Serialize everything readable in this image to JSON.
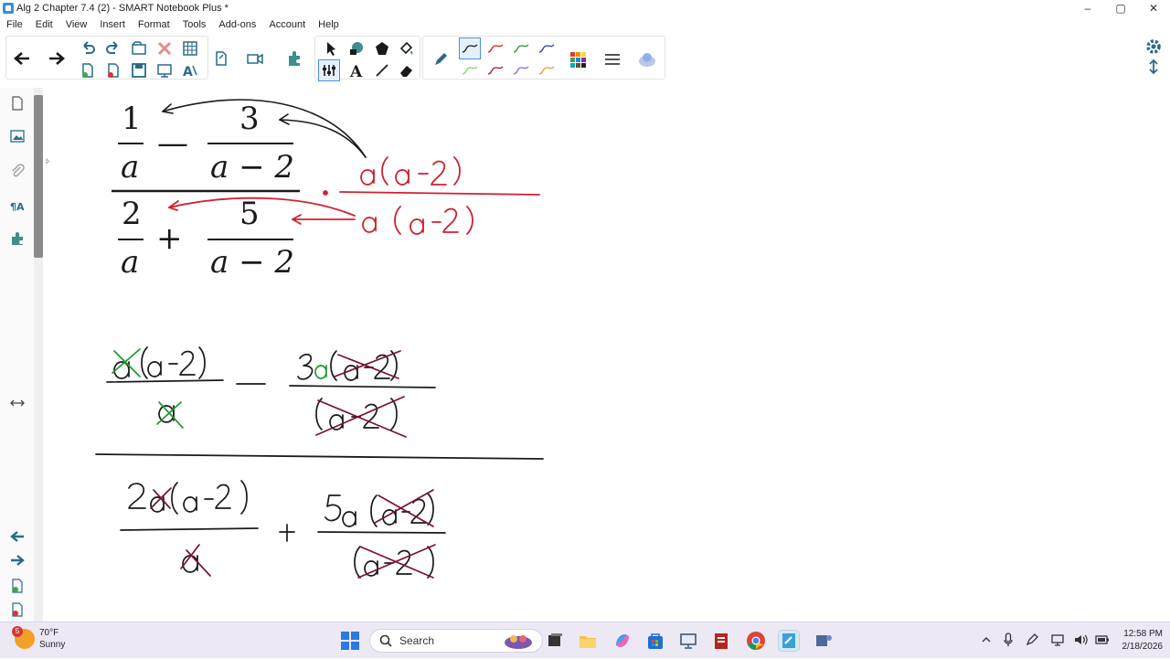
{
  "window": {
    "title": "Alg 2 Chapter 7.4 (2) - SMART Notebook Plus *",
    "controls": [
      "–",
      "▢",
      "✕"
    ]
  },
  "menu": [
    "File",
    "Edit",
    "View",
    "Insert",
    "Format",
    "Tools",
    "Add-ons",
    "Account",
    "Help"
  ],
  "toolbar": {
    "icons": [
      "back-arrow-icon",
      "forward-arrow-icon",
      "undo-icon",
      "redo-icon",
      "open-icon",
      "delete-icon",
      "table-icon",
      "new-page-icon",
      "close-page-icon",
      "save-icon",
      "screen-shade-icon",
      "text-recognition-icon",
      "screen-capture-icon",
      "record-icon",
      "addons-icon",
      "select-icon",
      "shapes-icon",
      "polygon-icon",
      "fill-icon",
      "properties-icon",
      "text-icon",
      "line-icon",
      "eraser-icon",
      "pen-icon",
      "pen-style-icon",
      "color-palette-icon",
      "line-width-icon",
      "fill-effect-icon"
    ]
  },
  "colors": {
    "ink_black": "#1a1a1a",
    "ink_red": "#d0202f",
    "ink_green": "#1f9a2e",
    "ink_maroon": "#7a1032",
    "accent": "#4a90d9"
  },
  "taskbar": {
    "weather_badge": "5",
    "temperature": "70°F",
    "condition": "Sunny",
    "search_placeholder": "Search",
    "time": "12:58 PM",
    "date": "2/18/2026"
  }
}
